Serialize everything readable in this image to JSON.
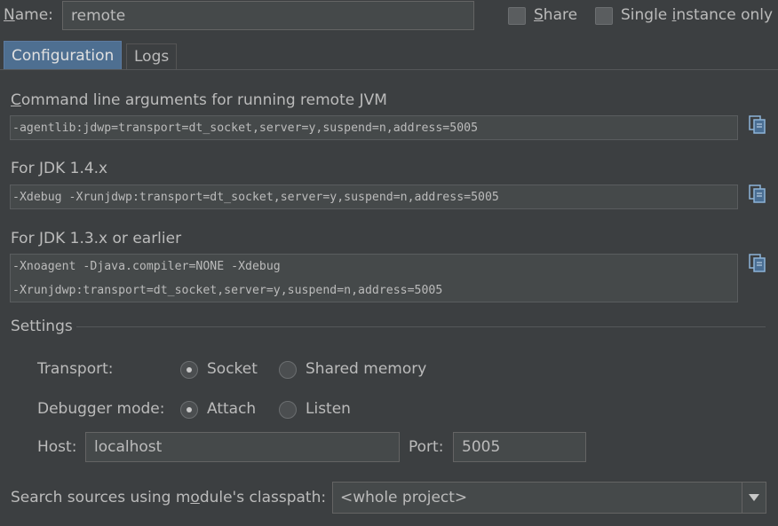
{
  "header": {
    "name_label": "Name:",
    "name_value": "remote",
    "share_label": "Share",
    "single_instance_label": "Single instance only"
  },
  "tabs": [
    {
      "label": "Configuration"
    },
    {
      "label": "Logs"
    }
  ],
  "config": {
    "cmd_label": "Command line arguments for running remote JVM",
    "cmd_value": "-agentlib:jdwp=transport=dt_socket,server=y,suspend=n,address=5005",
    "jdk14_label": "For JDK 1.4.x",
    "jdk14_value": "-Xdebug -Xrunjdwp:transport=dt_socket,server=y,suspend=n,address=5005",
    "jdk13_label": "For JDK 1.3.x or earlier",
    "jdk13_line1": "-Xnoagent -Djava.compiler=NONE -Xdebug",
    "jdk13_line2": "-Xrunjdwp:transport=dt_socket,server=y,suspend=n,address=5005"
  },
  "settings": {
    "title": "Settings",
    "transport_label": "Transport:",
    "transport_options": [
      "Socket",
      "Shared memory"
    ],
    "transport_selected": "Socket",
    "mode_label": "Debugger mode:",
    "mode_options": [
      "Attach",
      "Listen"
    ],
    "mode_selected": "Attach",
    "host_label": "Host:",
    "host_value": "localhost",
    "port_label": "Port:",
    "port_value": "5005"
  },
  "classpath": {
    "label": "Search sources using module's classpath:",
    "value": "<whole project>"
  },
  "icons": {
    "copy": "copy-icon",
    "dropdown": "chevron-down-icon"
  },
  "colors": {
    "background": "#3c3f41",
    "field_bg": "#45494a",
    "tab_active": "#4e6f91",
    "text": "#bbbbbb"
  }
}
